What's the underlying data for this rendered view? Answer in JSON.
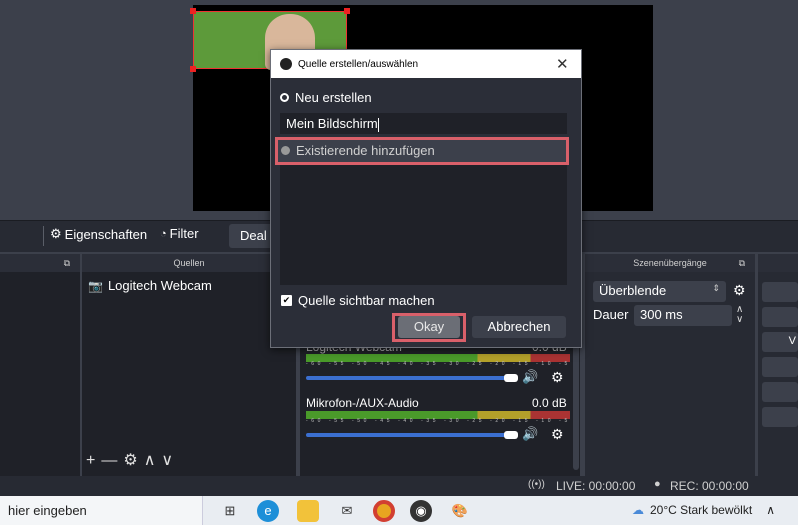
{
  "dialog": {
    "title": "Quelle erstellen/auswählen",
    "close_label": "✕",
    "new_label": "Neu erstellen",
    "name_value": "Mein Bildschirm",
    "existing_label": "Existierende hinzufügen",
    "visible_label": "Quelle sichtbar machen",
    "ok_label": "Okay",
    "cancel_label": "Abbrechen"
  },
  "toolbar": {
    "properties_label": "Eigenschaften",
    "filter_label": "Filter",
    "deal_label": "Deal"
  },
  "docks": {
    "sources_header": "Quellen",
    "transitions_header": "Szenenübergänge",
    "source_item": "Logitech Webcam"
  },
  "mixer": {
    "channel1_label": "Logitech Webcam",
    "channel1_db": "0.0 dB",
    "channel2_label": "Mikrofon-/AUX-Audio",
    "channel2_db": "0.0 dB",
    "ticks": "-60 -55 -50 -45 -40 -35 -30 -25 -20 -15 -10 -5 0"
  },
  "transitions": {
    "selected": "Überblende",
    "duration_label": "Dauer",
    "duration_value": "300 ms"
  },
  "status": {
    "live": "LIVE: 00:00:00",
    "rec": "REC: 00:00:00"
  },
  "taskbar": {
    "search_text": "hier eingeben",
    "weather": "20°C  Stark bewölkt"
  },
  "colors": {
    "highlight": "#d9606a",
    "accent_blue": "#3b6fd0"
  }
}
